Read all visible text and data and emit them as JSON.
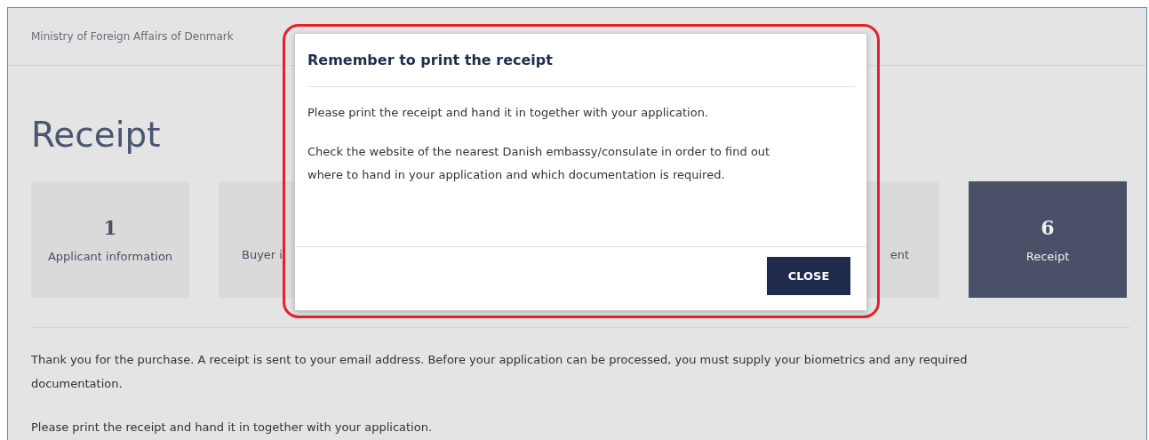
{
  "breadcrumb": "Ministry of Foreign Affairs of Denmark",
  "title": "Receipt",
  "steps": [
    {
      "number": "1",
      "label": "Applicant information",
      "selected": false,
      "kind": "full"
    },
    {
      "label": "Buyer i",
      "selected": false,
      "kind": "head"
    },
    {
      "label": "ent",
      "selected": false,
      "kind": "tail"
    },
    {
      "number": "6",
      "label": "Receipt",
      "selected": true,
      "kind": "full"
    }
  ],
  "paragraphs": [
    "Thank you for the purchase. A receipt is sent to your email address. Before your application can be processed, you must supply your biometrics and any required documentation.",
    "Please print the receipt and hand it in together with your application."
  ],
  "modal": {
    "title": "Remember to print the receipt",
    "body": [
      "Please print the receipt and hand it in together with your application.",
      "Check the website of the nearest Danish embassy/consulate in order to find out where to hand in your application and which documentation is required."
    ],
    "button": "CLOSE"
  }
}
